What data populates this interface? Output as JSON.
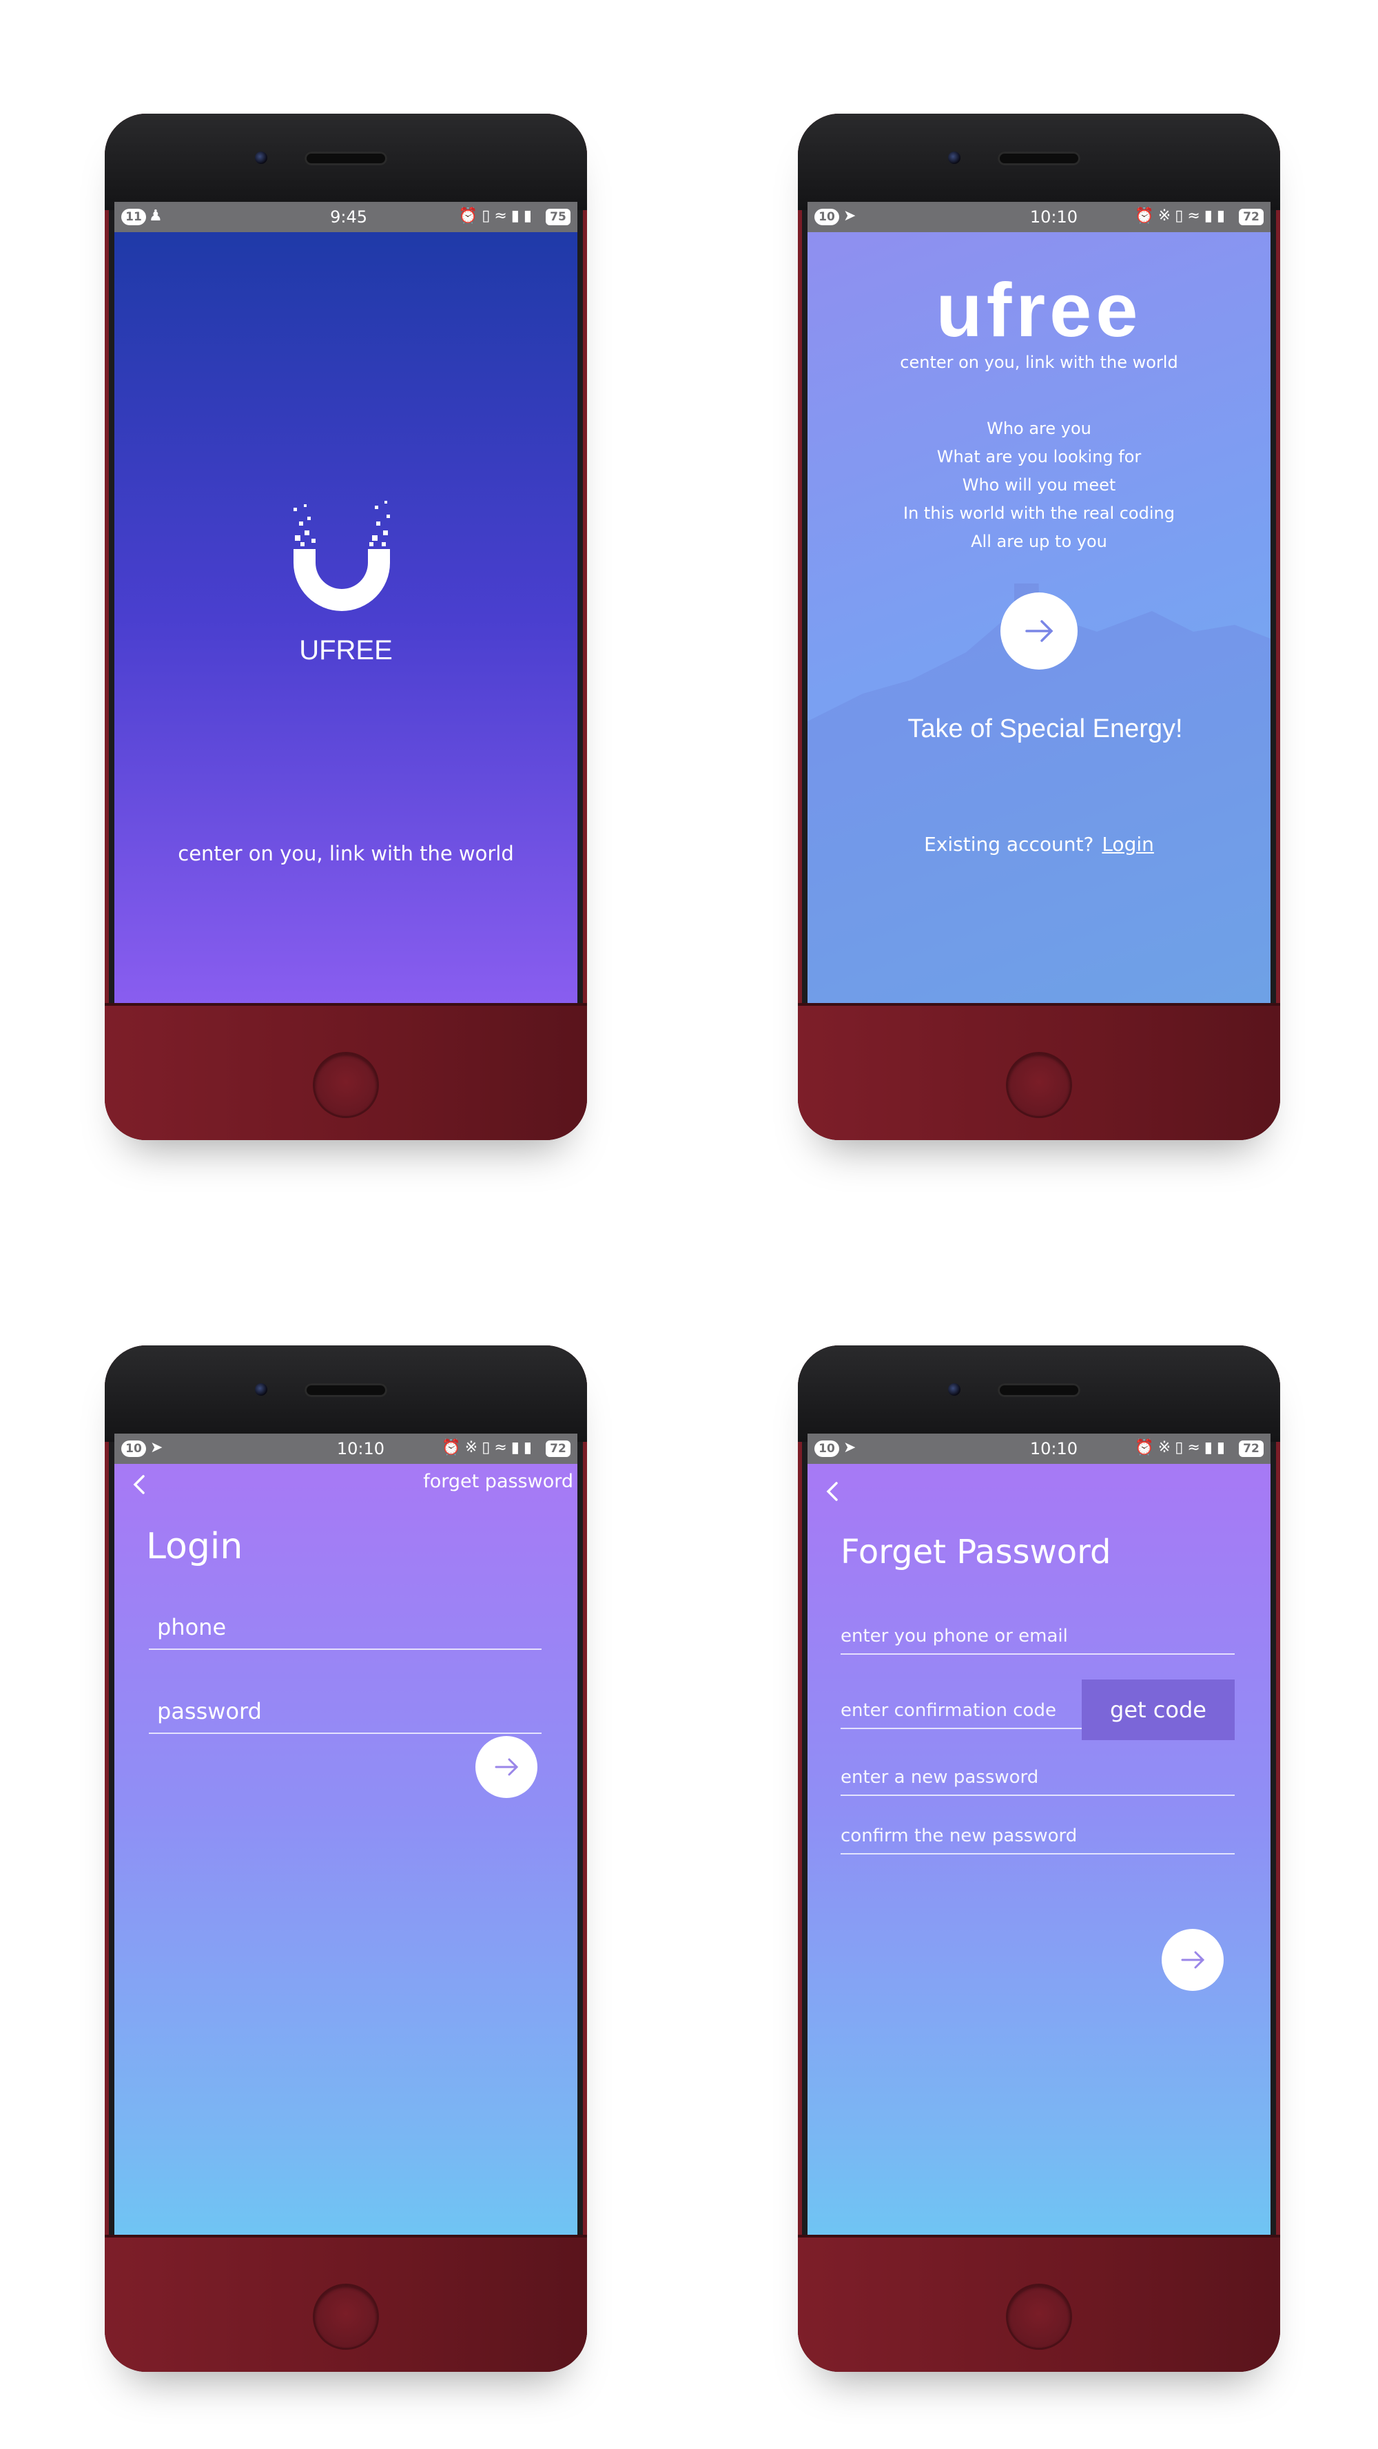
{
  "colors": {
    "phone_body": "#7a1d27",
    "screen1_gradient": [
      "#1f3aa8",
      "#8a5ef0"
    ],
    "screen2_gradient": [
      "#8f8ff0",
      "#6fb3ec"
    ],
    "screen34_gradient": [
      "#a779f5",
      "#6fc5f3"
    ],
    "get_code_button": "#7b66d8"
  },
  "screens": {
    "splash": {
      "status": {
        "left_badge": "11",
        "time": "9:45",
        "battery": "75"
      },
      "brand": "UFREE",
      "tagline": "center on you, link with the world",
      "logo_icon": "u-magnet-logo-icon"
    },
    "welcome": {
      "status": {
        "left_badge": "10",
        "time": "10:10",
        "battery": "72"
      },
      "logo_text": "ufree",
      "subtitle": "center on you, link with the world",
      "poem": [
        "Who are you",
        "What are you looking for",
        "Who will you meet",
        "In this world with the real coding",
        "All are up to you"
      ],
      "headline": "Take of Special Energy!",
      "existing_label": "Existing account?",
      "login_link": "Login"
    },
    "login": {
      "status": {
        "left_badge": "10",
        "time": "10:10",
        "battery": "72"
      },
      "forget_link": "forget password",
      "title": "Login",
      "phone_placeholder": "phone",
      "password_placeholder": "password"
    },
    "forget": {
      "status": {
        "left_badge": "10",
        "time": "10:10",
        "battery": "72"
      },
      "title": "Forget Password",
      "phone_email_placeholder": "enter you phone or email",
      "code_placeholder": "enter confirmation code",
      "get_code": "get code",
      "new_password_placeholder": "enter a new password",
      "confirm_password_placeholder": "confirm the new password"
    }
  }
}
